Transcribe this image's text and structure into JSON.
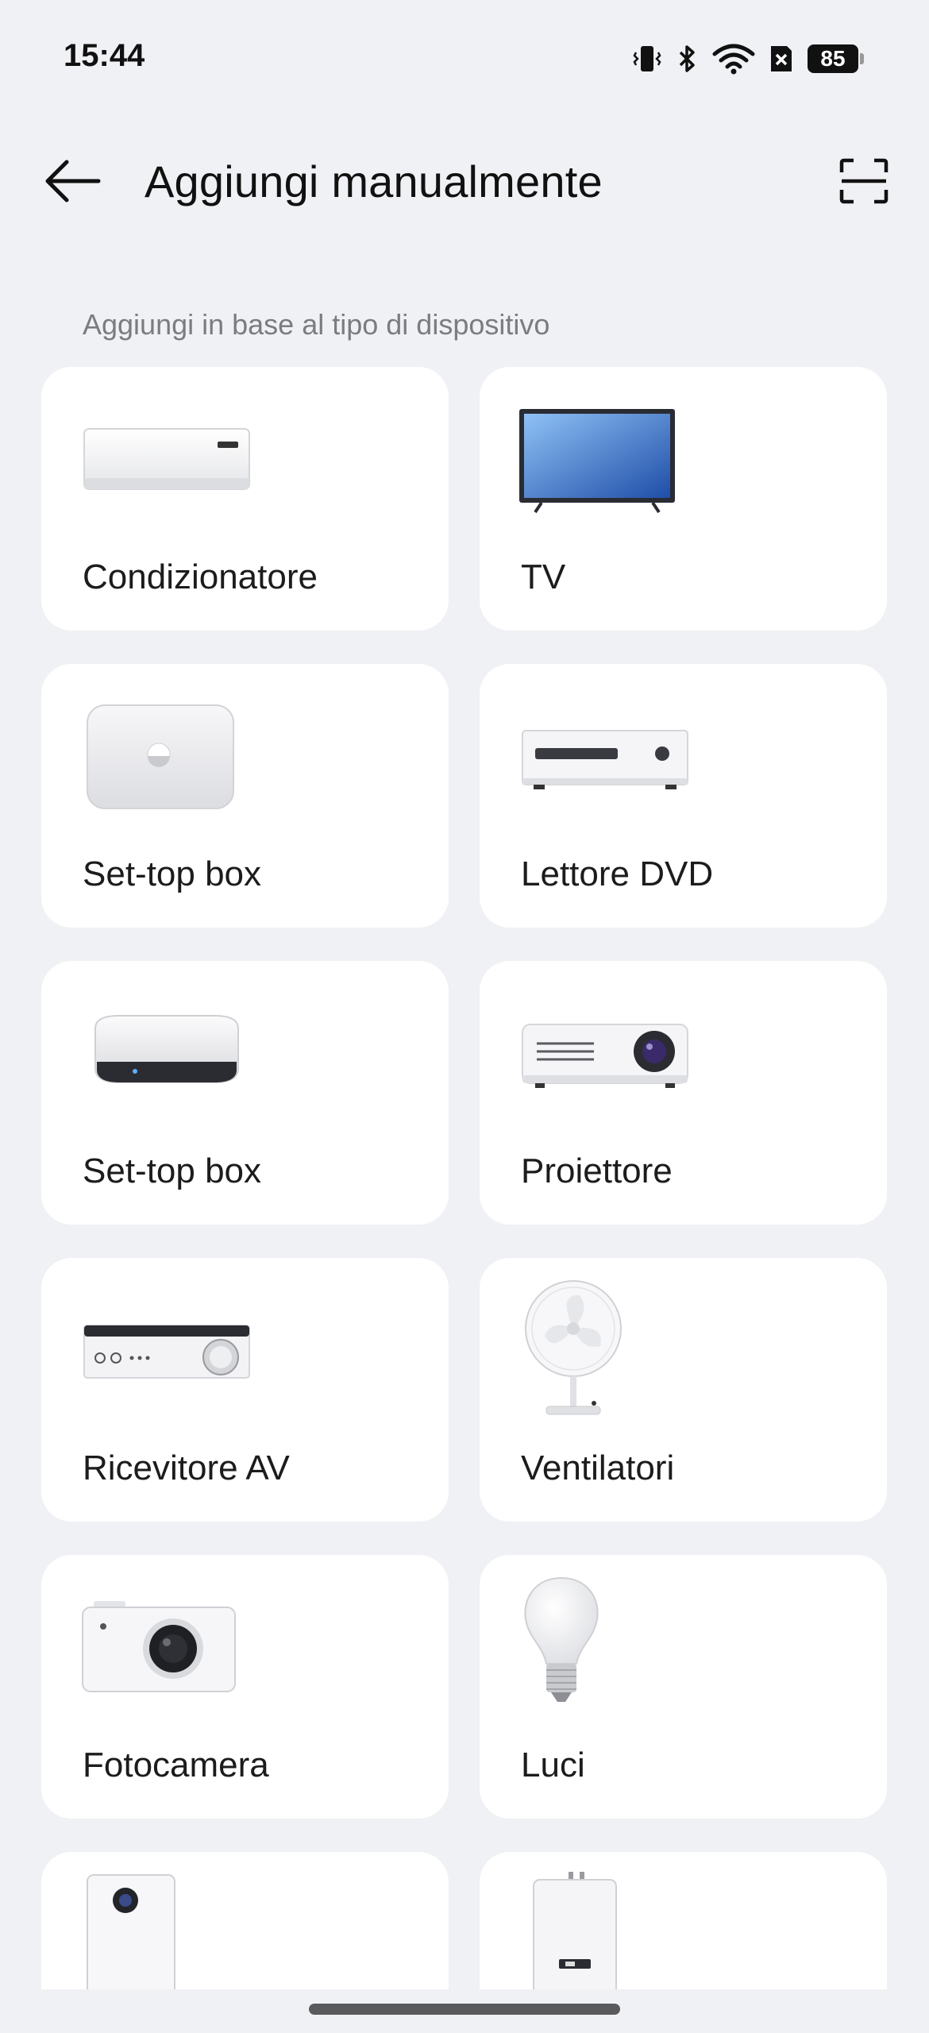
{
  "status_bar": {
    "time": "15:44",
    "battery_level": "85",
    "icons": [
      "vibrate-icon",
      "bluetooth-icon",
      "wifi-icon",
      "no-sim-icon",
      "battery-icon"
    ]
  },
  "app_bar": {
    "title": "Aggiungi manualmente",
    "back_icon": "arrow-left-icon",
    "scan_icon": "scan-icon"
  },
  "section": {
    "label": "Aggiungi in base al tipo di dispositivo"
  },
  "devices": [
    {
      "label": "Condizionatore",
      "icon": "air-conditioner-icon"
    },
    {
      "label": "TV",
      "icon": "tv-icon"
    },
    {
      "label": "Set-top box",
      "icon": "set-top-box-icon"
    },
    {
      "label": "Lettore DVD",
      "icon": "dvd-player-icon"
    },
    {
      "label": "Set-top box",
      "icon": "set-top-box-round-icon"
    },
    {
      "label": "Proiettore",
      "icon": "projector-icon"
    },
    {
      "label": "Ricevitore AV",
      "icon": "av-receiver-icon"
    },
    {
      "label": "Ventilatori",
      "icon": "fan-icon"
    },
    {
      "label": "Fotocamera",
      "icon": "camera-icon"
    },
    {
      "label": "Luci",
      "icon": "light-bulb-icon"
    },
    {
      "label": "",
      "icon": "air-purifier-icon"
    },
    {
      "label": "",
      "icon": "water-heater-icon"
    }
  ]
}
